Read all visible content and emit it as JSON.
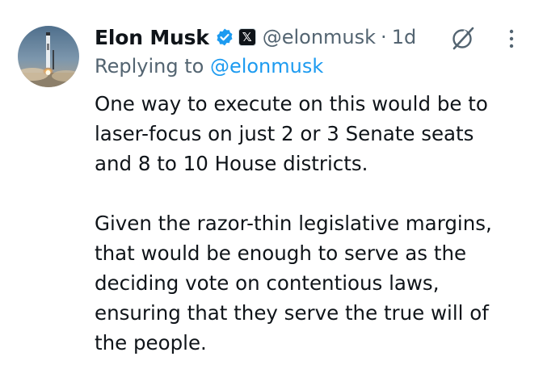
{
  "tweet": {
    "author_name": "Elon Musk",
    "handle": "@elonmusk",
    "separator": "·",
    "time": "1d",
    "x_badge": "𝕏",
    "replying_to_prefix": "Replying to ",
    "replying_to_handle": "@elonmusk",
    "paragraphs": [
      {
        "lines": [
          "One way to execute on this would be to",
          "laser-focus on just 2 or 3 Senate seats",
          "and 8 to 10 House districts."
        ]
      },
      {
        "lines": [
          "Given the razor-thin legislative margins,",
          "that would be enough to serve as the",
          "deciding vote on contentious laws,",
          "ensuring that they serve the true will of",
          "the people."
        ]
      }
    ]
  },
  "icons": {
    "verified": "verified-badge-icon",
    "grok": "grok-icon",
    "more": "more-options-icon",
    "avatar": "rocket-avatar"
  },
  "colors": {
    "text_primary": "#0f1419",
    "text_secondary": "#536471",
    "accent": "#1d9bf0"
  }
}
